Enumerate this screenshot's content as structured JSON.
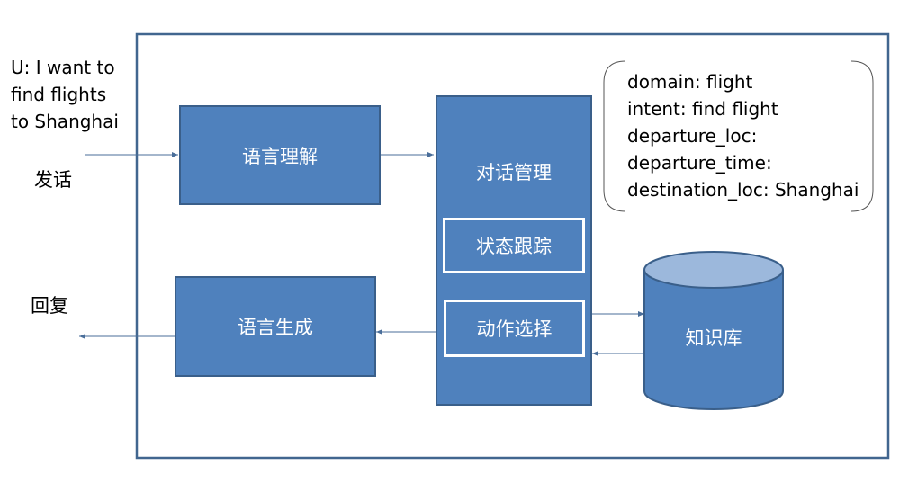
{
  "user_utterance": [
    "U: I want to",
    "find flights",
    "to Shanghai"
  ],
  "labels": {
    "speak": "发话",
    "reply": "回复"
  },
  "modules": {
    "nlu": "语言理解",
    "dm": "对话管理",
    "state_tracking": "状态跟踪",
    "action_selection": "动作选择",
    "nlg": "语言生成",
    "knowledge_base": "知识库"
  },
  "state_frame": [
    "domain: flight",
    "intent: find flight",
    "departure_loc:",
    "departure_time:",
    "destination_loc: Shanghai"
  ],
  "colors": {
    "box_fill": "#4f81bd",
    "box_border": "#3a5f8a",
    "cylinder_top": "#9cb8dc",
    "frame": "#41668f"
  }
}
